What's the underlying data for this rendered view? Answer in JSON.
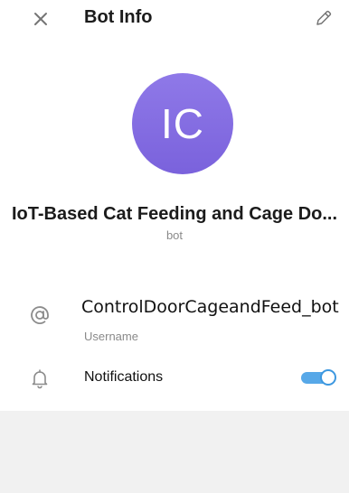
{
  "header": {
    "title": "Bot Info",
    "close_icon": "close-icon",
    "edit_icon": "pencil-icon"
  },
  "profile": {
    "avatar_initials": "IC",
    "avatar_color": "#8a72e4",
    "name": "IoT-Based Cat Feeding and Cage Do...",
    "subtitle": "bot"
  },
  "info": {
    "username_value": "ControlDoorCageandFeed_bot",
    "username_label": "Username",
    "username_icon": "at-icon",
    "notifications_label": "Notifications",
    "notifications_icon": "bell-icon",
    "notifications_enabled": true,
    "accent_color": "#3d98e0"
  }
}
